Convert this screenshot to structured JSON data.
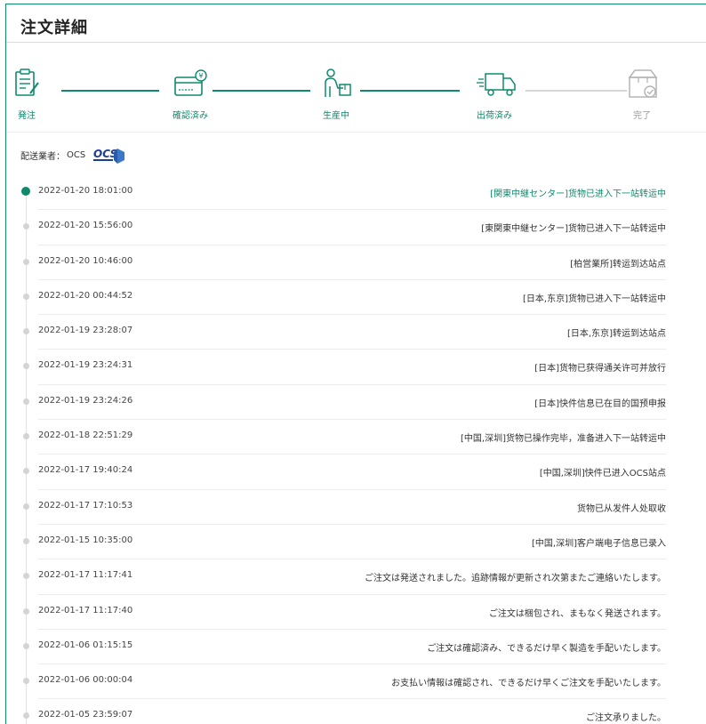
{
  "page": {
    "title": "注文詳細"
  },
  "steps": [
    {
      "label": "発注",
      "state": "done",
      "icon": "order-form-icon"
    },
    {
      "label": "確認済み",
      "state": "done",
      "icon": "payment-card-icon"
    },
    {
      "label": "生産中",
      "state": "done",
      "icon": "worker-package-icon"
    },
    {
      "label": "出荷済み",
      "state": "done",
      "icon": "delivery-truck-icon"
    },
    {
      "label": "完了",
      "state": "todo",
      "icon": "box-check-icon"
    }
  ],
  "carrier": {
    "label": "配送業者：",
    "name": "OCS",
    "logo_text": "OCS"
  },
  "timeline": [
    {
      "time": "2022-01-20 18:01:00",
      "desc": "[関東中継センター]货物已进入下一站转运中"
    },
    {
      "time": "2022-01-20 15:56:00",
      "desc": "[東関東中継センター]货物已进入下一站转运中"
    },
    {
      "time": "2022-01-20 10:46:00",
      "desc": "[柏営業所]转运到达站点"
    },
    {
      "time": "2022-01-20 00:44:52",
      "desc": "[日本,东京]货物已进入下一站转运中"
    },
    {
      "time": "2022-01-19 23:28:07",
      "desc": "[日本,东京]转运到达站点"
    },
    {
      "time": "2022-01-19 23:24:31",
      "desc": "[日本]货物已获得通关许可并放行"
    },
    {
      "time": "2022-01-19 23:24:26",
      "desc": "[日本]快件信息已在目的国预申报"
    },
    {
      "time": "2022-01-18 22:51:29",
      "desc": "[中国,深圳]货物已操作完毕，准备进入下一站转运中"
    },
    {
      "time": "2022-01-17 19:40:24",
      "desc": "[中国,深圳]快件已进入OCS站点"
    },
    {
      "time": "2022-01-17 17:10:53",
      "desc": "货物已从发件人处取收"
    },
    {
      "time": "2022-01-15 10:35:00",
      "desc": "[中国,深圳]客户端电子信息已录入"
    },
    {
      "time": "2022-01-17 11:17:41",
      "desc": "ご注文は発送されました。追跡情報が更新され次第またご連絡いたします。"
    },
    {
      "time": "2022-01-17 11:17:40",
      "desc": "ご注文は梱包され、まもなく発送されます。"
    },
    {
      "time": "2022-01-06 01:15:15",
      "desc": "ご注文は確認済み、できるだけ早く製造を手配いたします。"
    },
    {
      "time": "2022-01-06 00:00:04",
      "desc": "お支払い情報は確認され、できるだけ早くご注文を手配いたします。"
    },
    {
      "time": "2022-01-05 23:59:07",
      "desc": "ご注文承りました。"
    }
  ],
  "colors": {
    "accent": "#0f8a6c",
    "inactive": "#d6d6d6",
    "text": "#333333"
  }
}
